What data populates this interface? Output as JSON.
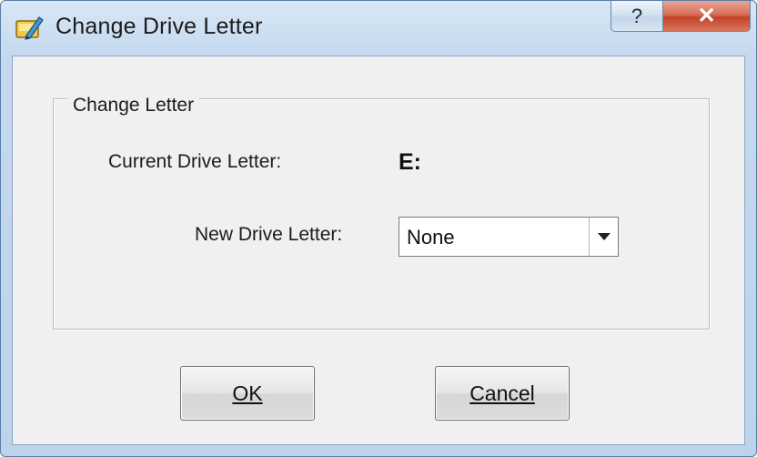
{
  "window": {
    "title": "Change Drive Letter",
    "help_label": "?",
    "close_label": "✕"
  },
  "group": {
    "legend": "Change Letter",
    "current_label": "Current Drive Letter:",
    "current_value": "E:",
    "new_label": "New Drive Letter:",
    "new_value": "None"
  },
  "buttons": {
    "ok_label": "OK",
    "cancel_label": "Cancel"
  },
  "icons": {
    "app_icon": "drive-pencil-icon",
    "dropdown": "chevron-down-icon"
  }
}
